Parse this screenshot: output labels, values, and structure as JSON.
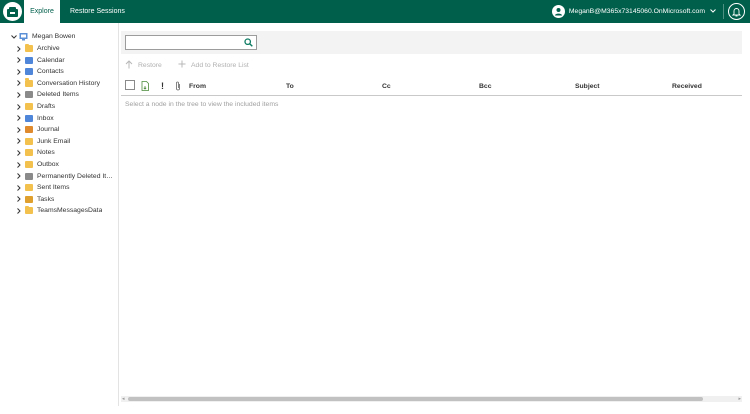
{
  "topbar": {
    "tabs": [
      {
        "label": "Explore"
      },
      {
        "label": "Restore Sessions"
      }
    ],
    "user": "MeganB@M365x73145060.OnMicrosoft.com"
  },
  "tree": {
    "root": {
      "label": "Megan Bowen"
    },
    "items": [
      {
        "label": "Archive",
        "icon": "folder-icon"
      },
      {
        "label": "Calendar",
        "icon": "calendar-icon"
      },
      {
        "label": "Contacts",
        "icon": "contacts-icon"
      },
      {
        "label": "Conversation History",
        "icon": "folder-icon"
      },
      {
        "label": "Deleted Items",
        "icon": "trash-icon"
      },
      {
        "label": "Drafts",
        "icon": "drafts-icon"
      },
      {
        "label": "Inbox",
        "icon": "inbox-icon"
      },
      {
        "label": "Journal",
        "icon": "journal-icon"
      },
      {
        "label": "Junk Email",
        "icon": "junk-icon"
      },
      {
        "label": "Notes",
        "icon": "notes-icon"
      },
      {
        "label": "Outbox",
        "icon": "outbox-icon"
      },
      {
        "label": "Permanently Deleted Ite...",
        "icon": "trash-icon"
      },
      {
        "label": "Sent Items",
        "icon": "sent-icon"
      },
      {
        "label": "Tasks",
        "icon": "tasks-icon"
      },
      {
        "label": "TeamsMessagesData",
        "icon": "folder-icon"
      }
    ]
  },
  "search": {
    "value": "",
    "placeholder": ""
  },
  "actions": {
    "restore": "Restore",
    "add_to_restore_list": "Add to Restore List"
  },
  "table": {
    "columns": {
      "from": "From",
      "to": "To",
      "cc": "Cc",
      "bcc": "Bcc",
      "subject": "Subject",
      "received": "Received"
    },
    "empty_message": "Select a node in the tree to view the included items"
  },
  "colors": {
    "brand": "#005f4b",
    "folder": "#f2c14e",
    "search_icon": "#0c7a61"
  }
}
